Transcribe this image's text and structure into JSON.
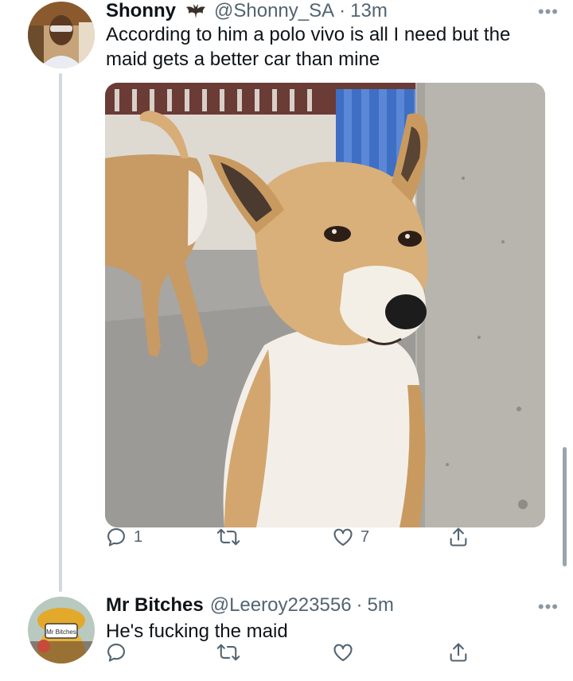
{
  "tweets": [
    {
      "name": "Shonny",
      "badge_icon": "bat-emoji-icon",
      "handle": "@Shonny_SA",
      "separator": "·",
      "time": "13m",
      "text_line1": "According to him a polo vivo is all I need but the",
      "text_line2": "maid gets a better car than mine",
      "has_media": true,
      "actions": {
        "reply": "1",
        "retweet": "",
        "like": "7"
      }
    },
    {
      "name": "Mr Bitches",
      "handle": "@Leeroy223556",
      "separator": "·",
      "time": "5m",
      "text": "He's fucking the maid",
      "avatar_sign_text": "Mr Bitches",
      "actions": {
        "reply": "",
        "retweet": "",
        "like": ""
      }
    }
  ],
  "more_label": "•••",
  "colors": {
    "secondary_text": "#536471",
    "thread_line": "#cfd9de"
  }
}
